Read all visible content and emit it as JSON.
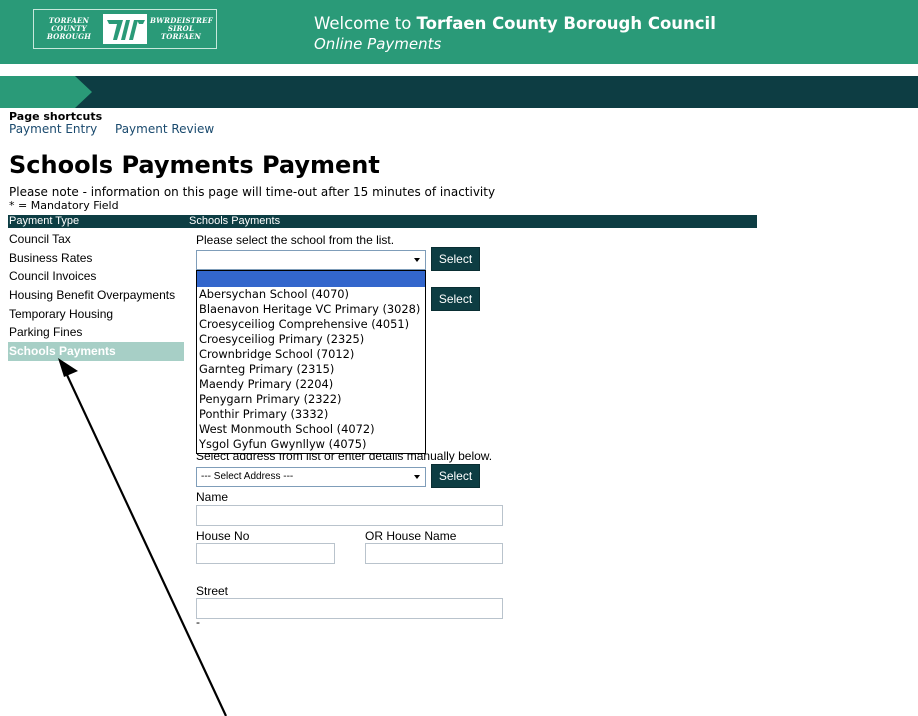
{
  "header": {
    "logo_left": [
      "TORFAEN",
      "COUNTY",
      "BOROUGH"
    ],
    "logo_right": [
      "BWRDEISTREF",
      "SIROL",
      "TORFAEN"
    ],
    "welcome_prefix": "Welcome to",
    "council_name": "Torfaen County Borough Council",
    "subtitle": "Online Payments"
  },
  "shortcuts": {
    "title": "Page shortcuts",
    "links": [
      "Payment Entry",
      "Payment Review"
    ]
  },
  "page": {
    "title": "Schools Payments Payment",
    "note": "Please note - information on this page will time-out after 15 minutes of inactivity",
    "mandatory": "* = Mandatory Field"
  },
  "table_header": {
    "left": "Payment Type",
    "right": "Schools Payments"
  },
  "sidebar": {
    "items": [
      {
        "label": "Council Tax"
      },
      {
        "label": "Business Rates"
      },
      {
        "label": "Council Invoices"
      },
      {
        "label": "Housing Benefit Overpayments"
      },
      {
        "label": "Temporary Housing"
      },
      {
        "label": "Parking Fines"
      },
      {
        "label": "Schools Payments",
        "active": true
      }
    ]
  },
  "form": {
    "school_prompt": "Please select the school from the list.",
    "select_label": "Select",
    "school_options": [
      "Abersychan School (4070)",
      "Blaenavon Heritage VC Primary (3028)",
      "Croesyceiliog Comprehensive (4051)",
      "Croesyceiliog Primary (2325)",
      "Crownbridge School (7012)",
      "Garnteg Primary (2315)",
      "Maendy Primary (2204)",
      "Penygarn Primary (2322)",
      "Ponthir Primary (3332)",
      "West Monmouth School (4072)",
      "Ysgol Gyfun Gwynllyw (4075)"
    ],
    "address_prompt": "Select address from list or enter details manually below.",
    "address_placeholder": "--- Select Address ---",
    "name_label": "Name",
    "house_no_label": "House No",
    "house_name_label": "OR House Name",
    "street_label": "Street",
    "street_after": "-"
  },
  "colors": {
    "header_green": "#2a9a78",
    "dark_teal": "#0d3d43",
    "active_item_bg": "#a7cfc6",
    "dropdown_highlight": "#3366cc"
  }
}
